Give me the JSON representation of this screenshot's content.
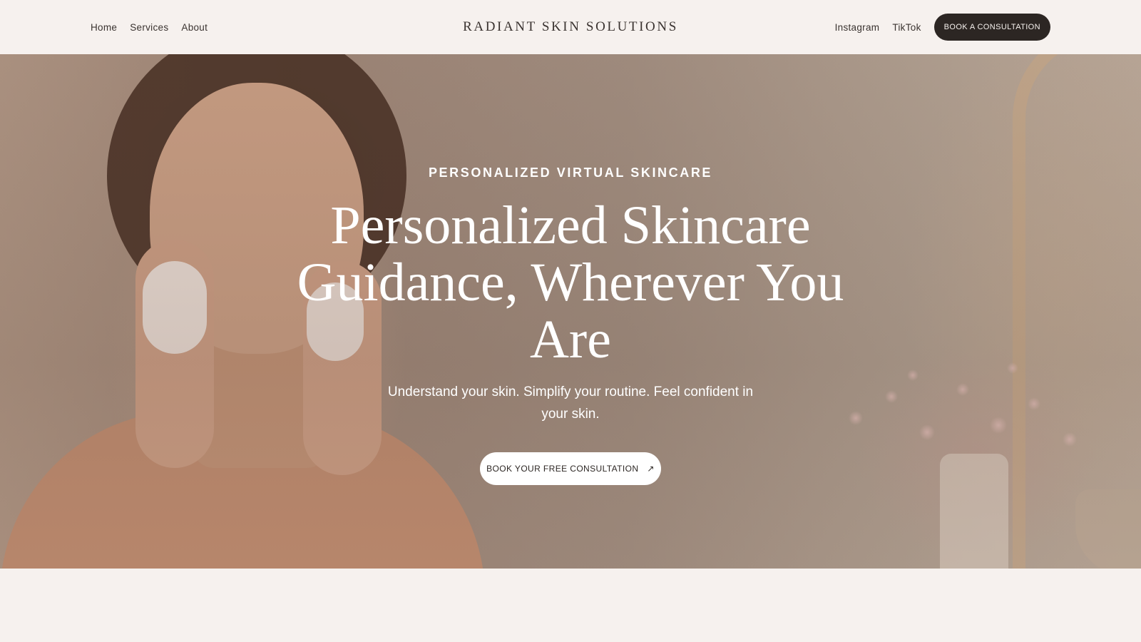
{
  "nav": {
    "left_links": [
      "Home",
      "Services",
      "About"
    ],
    "brand": "RADIANT SKIN SOLUTIONS",
    "right_links": [
      "Instagram",
      "TikTok"
    ],
    "cta_label": "BOOK A CONSULTATION"
  },
  "hero": {
    "eyebrow": "PERSONALIZED VIRTUAL SKINCARE",
    "headline": "Personalized Skincare Guidance, Wherever You Are",
    "subheadline": "Understand your skin. Simplify your routine. Feel confident in your skin.",
    "cta_label": "BOOK YOUR FREE CONSULTATION",
    "cta_icon": "arrow-up-right-icon",
    "image_description": ""
  },
  "colors": {
    "background": "#f6f1ee",
    "dark_button": "#2c2623",
    "text_dark": "#3a3330"
  }
}
